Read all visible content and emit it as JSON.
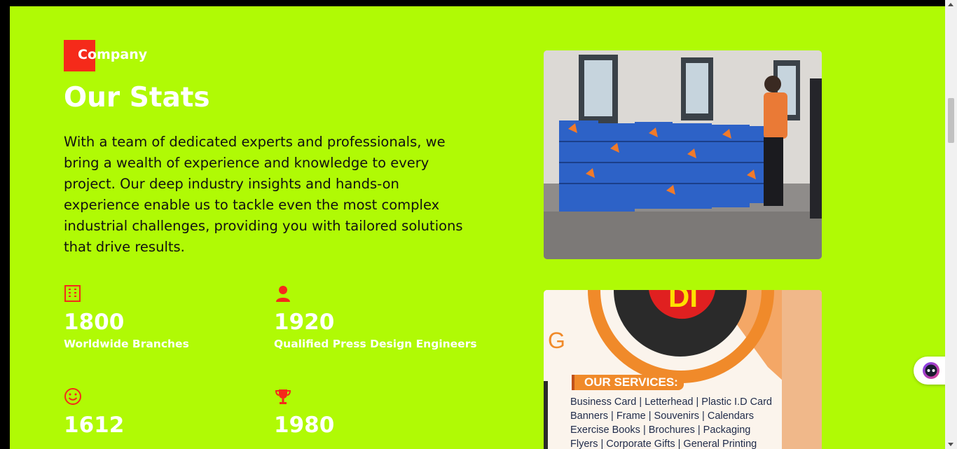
{
  "section": {
    "tag": "Company",
    "title": "Our Stats",
    "intro": "With a team of dedicated experts and professionals, we bring a wealth of experience and knowledge to every project. Our deep industry insights and hands-on experience enable us to tackle even the most complex industrial challenges, providing you with tailored solutions that drive results."
  },
  "stats": [
    {
      "icon": "building-icon",
      "value": "1800",
      "label": "Worldwide Branches"
    },
    {
      "icon": "user-icon",
      "value": "1920",
      "label": "Qualified Press Design Engineers"
    },
    {
      "icon": "smile-icon",
      "value": "1612",
      "label": ""
    },
    {
      "icon": "trophy-icon",
      "value": "1980",
      "label": ""
    }
  ],
  "flyer": {
    "heading": "OUR SERVICES:",
    "big_letters": "DI",
    "partial_letter": "G",
    "lines": [
      "Business Card | Letterhead | Plastic I.D Card",
      "Banners | Frame | Souvenirs | Calendars",
      "Exercise Books | Brochures | Packaging",
      "Flyers | Corporate Gifts | General Printing"
    ]
  },
  "colors": {
    "background": "#b0fa05",
    "accent": "#f52a1a",
    "text_dark": "#111111",
    "text_light": "#ffffff"
  }
}
